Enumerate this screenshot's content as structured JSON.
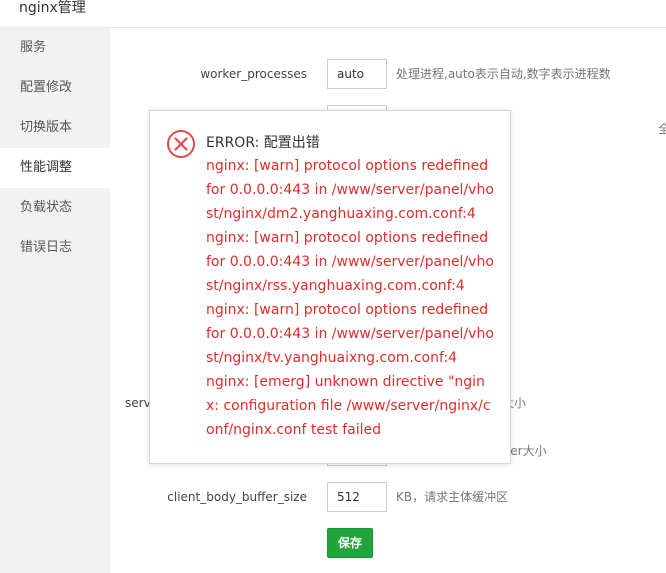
{
  "window": {
    "title": "nginx管理"
  },
  "sidebar": {
    "items": [
      {
        "label": "服务"
      },
      {
        "label": "配置修改"
      },
      {
        "label": "切换版本"
      },
      {
        "label": "性能调整"
      },
      {
        "label": "负载状态"
      },
      {
        "label": "错误日志"
      }
    ],
    "active_index": 3
  },
  "form": {
    "rows": [
      {
        "label": "worker_processes",
        "value": "auto",
        "hint": "处理进程,auto表示自动,数字表示进程数"
      },
      {
        "label": "serv",
        "hint": "大小"
      },
      {
        "hint": "ffer大小"
      },
      {
        "label": "client_body_buffer_size",
        "value": "512",
        "hint": "KB，请求主体缓冲区"
      }
    ],
    "save_label": "保存",
    "edge_glyph": "全"
  },
  "dialog": {
    "title": "ERROR: 配置出错",
    "lines": [
      "nginx: [warn] protocol options redefined for 0.0.0.0:443 in /www/server/panel/vhost/nginx/dm2.yanghuaxing.com.conf:4",
      "nginx: [warn] protocol options redefined for 0.0.0.0:443 in /www/server/panel/vhost/nginx/rss.yanghuaxing.com.conf:4",
      "nginx: [warn] protocol options redefined for 0.0.0.0:443 in /www/server/panel/vhost/nginx/tv.yanghuaixng.com.conf:4",
      "nginx: [emerg] unknown directive \"nginx: configuration file /www/server/nginx/conf/nginx.conf test failed"
    ]
  },
  "colors": {
    "accent": "#20a53a",
    "error": "#e02c2c"
  }
}
